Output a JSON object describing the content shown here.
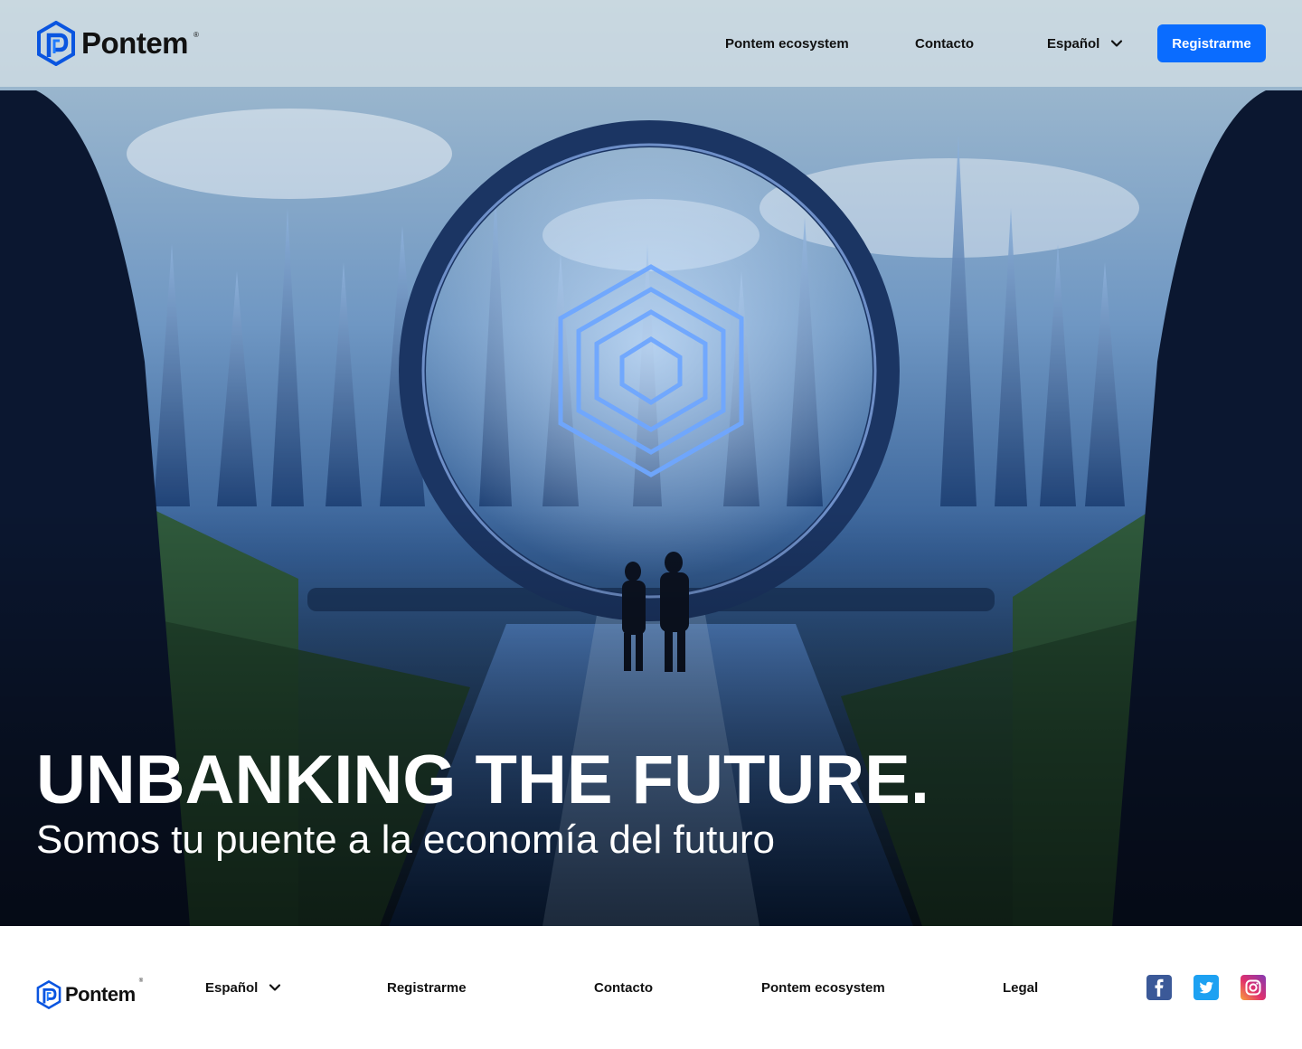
{
  "header": {
    "logo_text": "Pontem",
    "logo_reg": "®",
    "nav": {
      "ecosystem": "Pontem ecosystem",
      "contact": "Contacto",
      "language": "Español"
    },
    "register_button": "Registrarme"
  },
  "hero": {
    "title": "UNBANKING THE FUTURE.",
    "subtitle": "Somos tu puente a la economía del futuro"
  },
  "footer": {
    "logo_text": "Pontem",
    "logo_reg": "®",
    "language": "Español",
    "register": "Registrarme",
    "contact": "Contacto",
    "ecosystem": "Pontem ecosystem",
    "legal": "Legal",
    "social": [
      "facebook-icon",
      "twitter-icon",
      "instagram-icon"
    ]
  },
  "colors": {
    "brand_blue": "#0a6cff",
    "header_bg": "#d6e0e6",
    "facebook": "#3b5998",
    "twitter": "#1da1f2"
  }
}
